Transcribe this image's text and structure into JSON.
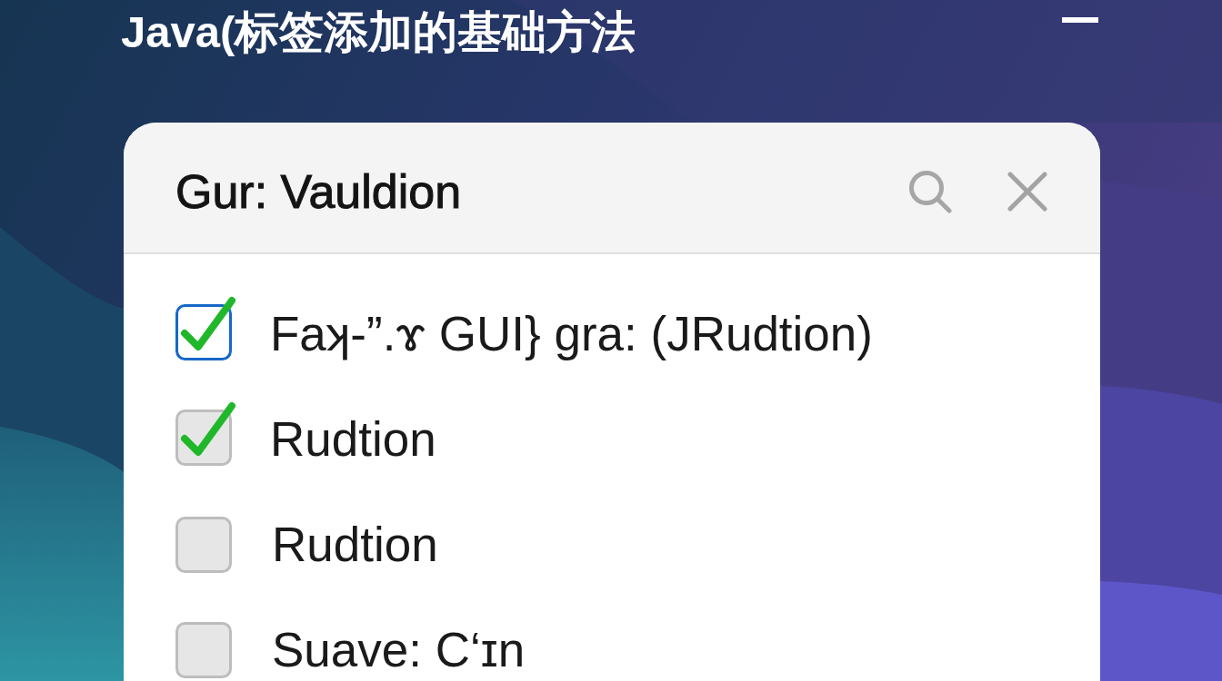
{
  "window": {
    "title": "Java(标签添加的基础方法"
  },
  "dialog": {
    "title": "Gur: Vauldion",
    "items": [
      {
        "label": "Faʞ-”.ɤ GUI} gra: (JRudtion)",
        "checked": true,
        "focused": true
      },
      {
        "label": "Rudtion",
        "checked": true,
        "focused": false
      },
      {
        "label": "Rudtion",
        "checked": false,
        "focused": false
      },
      {
        "label": "Suave: C‘ɪn",
        "checked": false,
        "focused": false
      }
    ]
  }
}
